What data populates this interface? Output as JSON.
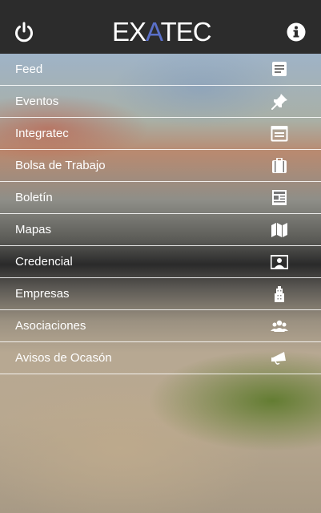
{
  "app": {
    "logo_pre": "EX",
    "logo_accent": "A",
    "logo_post": "TEC"
  },
  "colors": {
    "header_bg": "#2c2c2c",
    "logo_accent": "#5a70c9",
    "text": "#ffffff"
  },
  "header_icons": {
    "left": "power-icon",
    "right": "info-icon"
  },
  "menu": {
    "items": [
      {
        "label": "Feed",
        "icon": "feed-icon"
      },
      {
        "label": "Eventos",
        "icon": "pin-icon"
      },
      {
        "label": "Integratec",
        "icon": "browser-icon"
      },
      {
        "label": "Bolsa de Trabajo",
        "icon": "briefcase-icon"
      },
      {
        "label": "Boletín",
        "icon": "newspaper-icon"
      },
      {
        "label": "Mapas",
        "icon": "map-icon"
      },
      {
        "label": "Credencial",
        "icon": "id-card-icon"
      },
      {
        "label": "Empresas",
        "icon": "building-icon"
      },
      {
        "label": "Asociaciones",
        "icon": "group-icon"
      },
      {
        "label": "Avisos de Ocasón",
        "icon": "megaphone-icon"
      }
    ]
  }
}
